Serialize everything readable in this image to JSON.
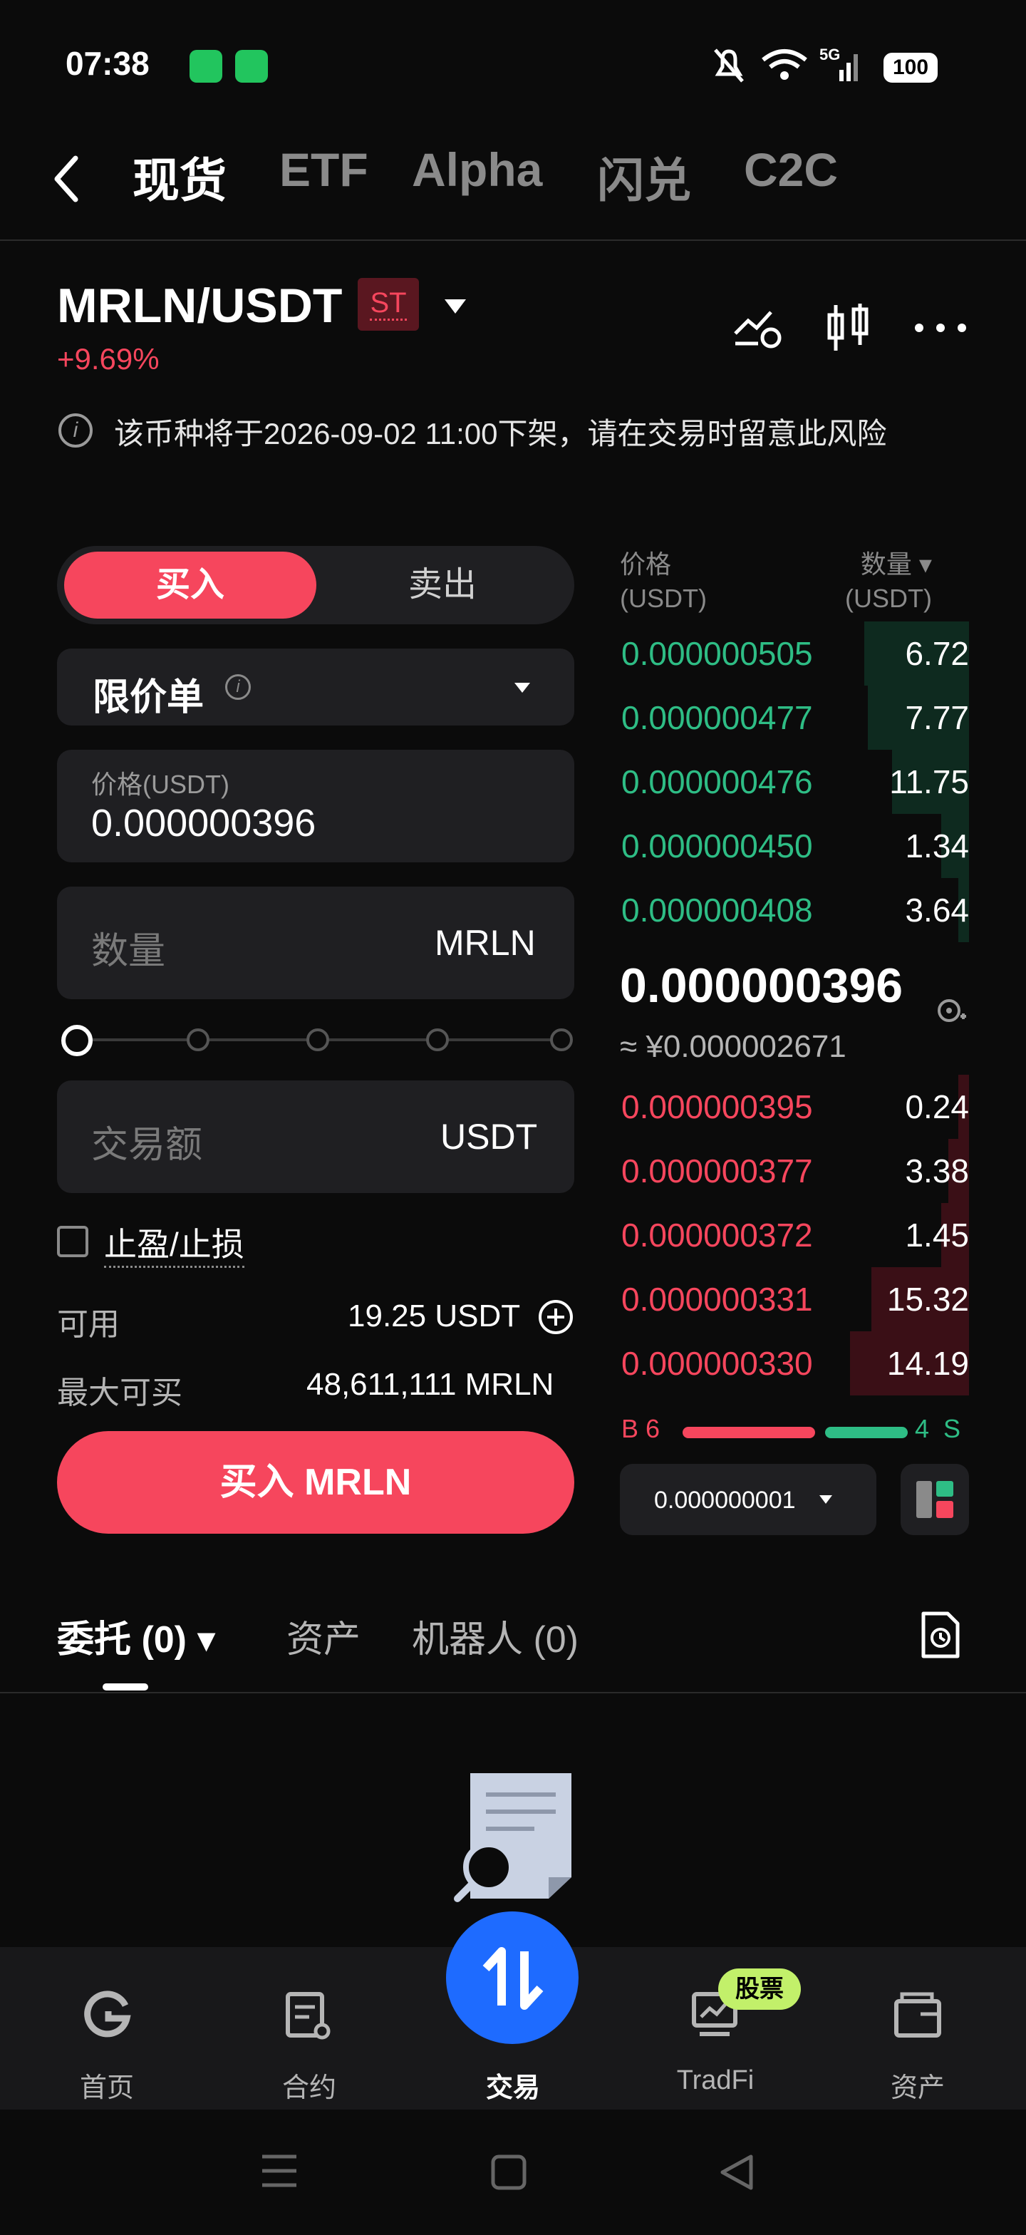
{
  "status": {
    "time": "07:38",
    "battery": "100",
    "network": "5G"
  },
  "top_tabs": [
    {
      "label": "现货",
      "active": true
    },
    {
      "label": "ETF",
      "active": false
    },
    {
      "label": "Alpha",
      "active": false
    },
    {
      "label": "闪兑",
      "active": false
    },
    {
      "label": "C2C",
      "active": false
    }
  ],
  "pair": {
    "symbol": "MRLN/USDT",
    "badge": "ST",
    "change": "+9.69%"
  },
  "notice": {
    "text": "该币种将于2026-09-02 11:00下架，请在交易时留意此风险"
  },
  "order_form": {
    "buy_label": "买入",
    "sell_label": "卖出",
    "order_type": "限价单",
    "price_caption": "价格(USDT)",
    "price_value": "0.000000396",
    "qty_placeholder": "数量",
    "qty_unit": "MRLN",
    "amount_placeholder": "交易额",
    "amount_unit": "USDT",
    "tpsl_label": "止盈/止损",
    "available_label": "可用",
    "available_value": "19.25 USDT",
    "max_buy_label": "最大可买",
    "max_buy_value": "48,611,111 MRLN",
    "submit_label": "买入 MRLN"
  },
  "order_book": {
    "price_header": "价格",
    "price_header_unit": "(USDT)",
    "qty_header": "数量",
    "qty_header_unit": "(USDT)",
    "asks": [
      {
        "price": "0.000000505",
        "qty": "6.72",
        "depth": 0.3
      },
      {
        "price": "0.000000477",
        "qty": "7.77",
        "depth": 0.29
      },
      {
        "price": "0.000000476",
        "qty": "11.75",
        "depth": 0.22
      },
      {
        "price": "0.000000450",
        "qty": "1.34",
        "depth": 0.08
      },
      {
        "price": "0.000000408",
        "qty": "3.64",
        "depth": 0.03
      }
    ],
    "last_price": "0.000000396",
    "cny_price": "≈ ¥0.000002671",
    "bids": [
      {
        "price": "0.000000395",
        "qty": "0.24",
        "depth": 0.03
      },
      {
        "price": "0.000000377",
        "qty": "3.38",
        "depth": 0.06
      },
      {
        "price": "0.000000372",
        "qty": "1.45",
        "depth": 0.08
      },
      {
        "price": "0.000000331",
        "qty": "15.32",
        "depth": 0.28
      },
      {
        "price": "0.000000330",
        "qty": "14.19",
        "depth": 0.34
      }
    ],
    "bid_label": "B 6",
    "ask_label": "4  S",
    "precision": "0.000000001"
  },
  "bottom_tabs": [
    {
      "label": "委托 (0)",
      "active": true
    },
    {
      "label": "资产",
      "active": false
    },
    {
      "label": "机器人 (0)",
      "active": false
    }
  ],
  "nav": [
    {
      "label": "首页",
      "icon": "home-icon",
      "active": false
    },
    {
      "label": "合约",
      "icon": "futures-icon",
      "active": false
    },
    {
      "label": "交易",
      "icon": "trade-icon",
      "active": true
    },
    {
      "label": "TradFi",
      "icon": "tradfi-icon",
      "active": false,
      "badge": "股票"
    },
    {
      "label": "资产",
      "icon": "wallet-icon",
      "active": false
    }
  ],
  "colors": {
    "buy": "#f6465d",
    "ask_green": "#2ebd85",
    "panel": "#1f1f22",
    "accent_blue": "#1e6bff"
  }
}
